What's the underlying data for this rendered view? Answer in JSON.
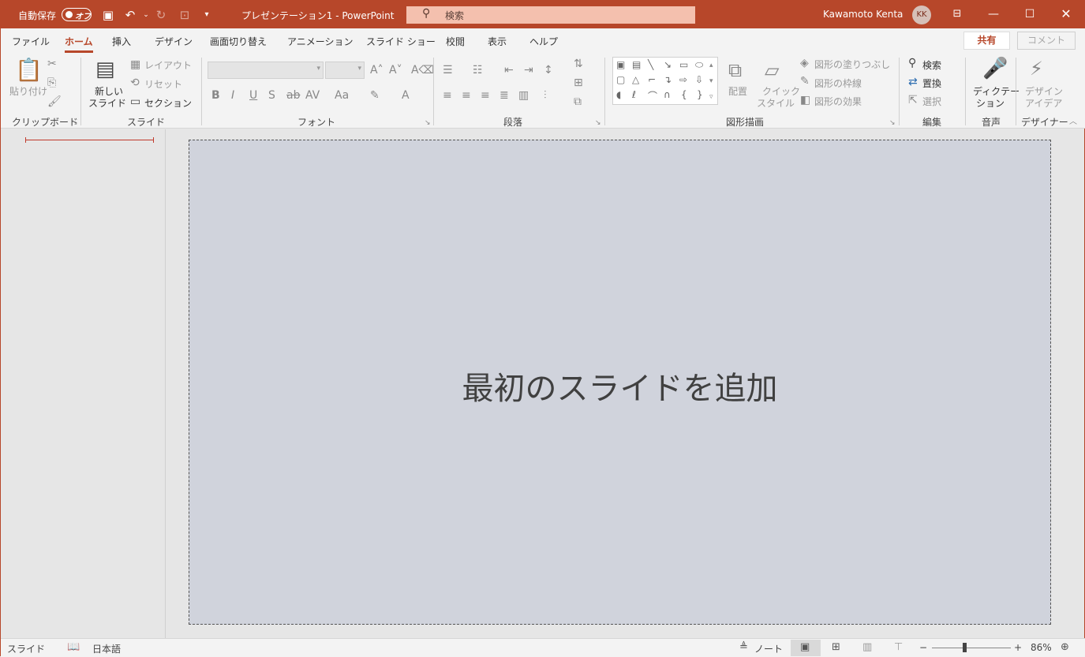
{
  "titlebar": {
    "autosave_label": "自動保存",
    "autosave_state": "オフ",
    "doc_title": "プレゼンテーション1  -  PowerPoint",
    "search_placeholder": "検索",
    "username": "Kawamoto Kenta",
    "avatar_initials": "KK"
  },
  "tabs": [
    "ファイル",
    "ホーム",
    "挿入",
    "デザイン",
    "画面切り替え",
    "アニメーション",
    "スライド ショー",
    "校閲",
    "表示",
    "ヘルプ"
  ],
  "active_tab": "ホーム",
  "share_label": "共有",
  "comment_label": "コメント",
  "ribbon": {
    "clipboard": {
      "paste": "貼り付け",
      "group": "クリップボード"
    },
    "slides": {
      "new_slide_1": "新しい",
      "new_slide_2": "スライド",
      "layout": "レイアウト",
      "reset": "リセット",
      "section": "セクション",
      "group": "スライド"
    },
    "font": {
      "group": "フォント"
    },
    "paragraph": {
      "group": "段落"
    },
    "drawing": {
      "arrange": "配置",
      "quick_style_1": "クイック",
      "quick_style_2": "スタイル",
      "fill": "図形の塗りつぶし",
      "outline": "図形の枠線",
      "effects": "図形の効果",
      "group": "図形描画"
    },
    "editing": {
      "find": "検索",
      "replace": "置換",
      "select": "選択",
      "group": "編集"
    },
    "voice": {
      "dictate_1": "ディクテー",
      "dictate_2": "ション",
      "group": "音声"
    },
    "designer": {
      "ideas_1": "デザイン",
      "ideas_2": "アイデア",
      "group": "デザイナー"
    }
  },
  "slide": {
    "prompt": "最初のスライドを追加"
  },
  "statusbar": {
    "slide_label": "スライド",
    "language": "日本語",
    "notes": "ノート",
    "zoom": "86%"
  }
}
